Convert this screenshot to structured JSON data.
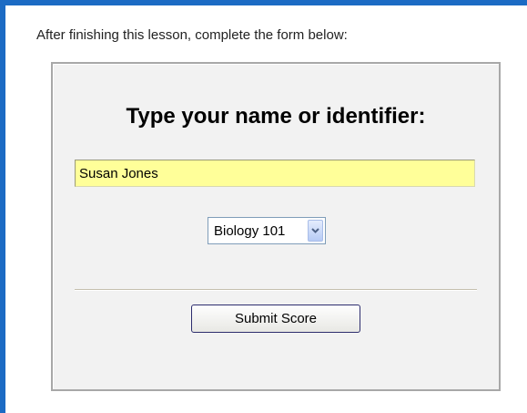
{
  "instructions": "After finishing this lesson, complete the form below:",
  "form": {
    "title": "Type your name or identifier:",
    "name_value": "Susan Jones",
    "course_select": {
      "selected": "Biology 101"
    },
    "submit_label": "Submit Score"
  },
  "colors": {
    "frame_accent": "#1c6bc4",
    "input_highlight": "#ffff99",
    "panel_background": "#f2f2f2"
  },
  "icons": {
    "select_arrow": "chevron-down-icon"
  }
}
